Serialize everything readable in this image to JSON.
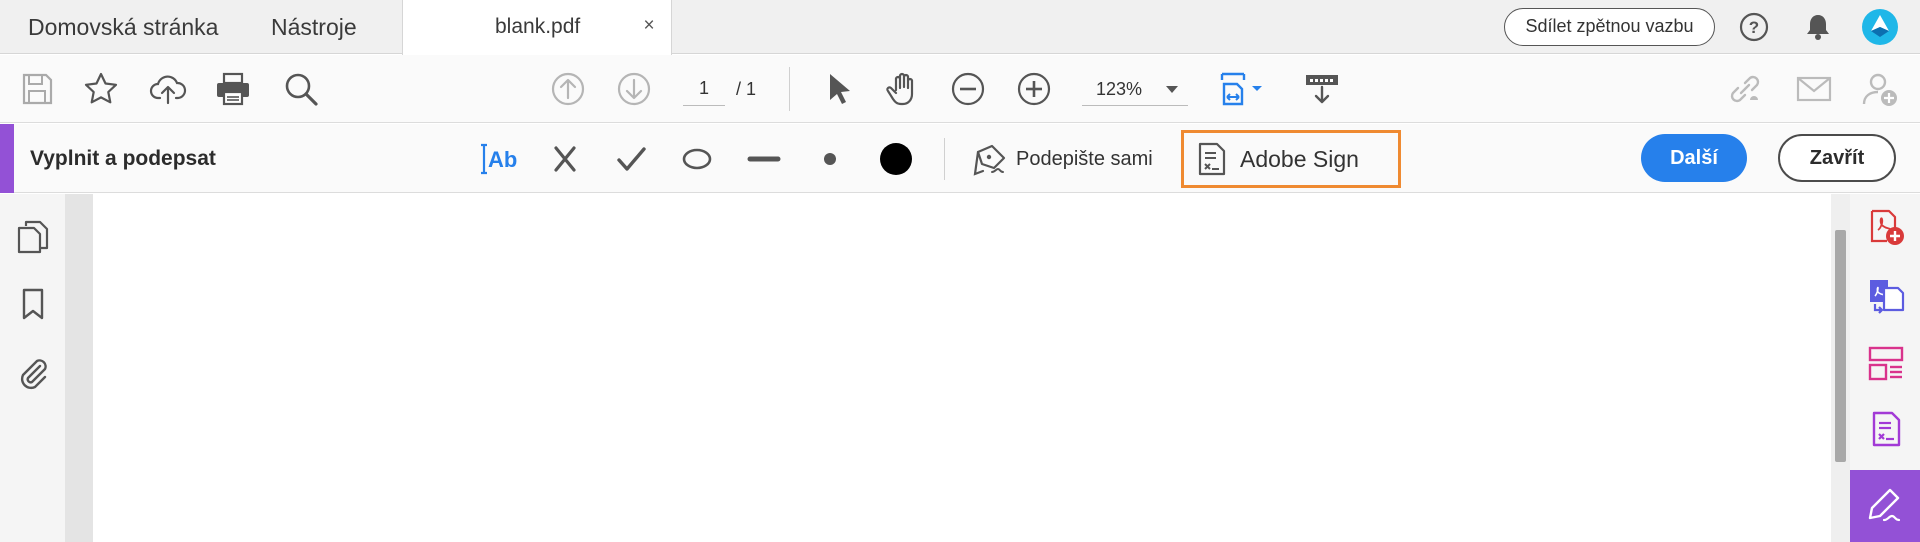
{
  "tabs": {
    "home_label": "Domovská stránka",
    "tools_label": "Nástroje",
    "document_label": "blank.pdf",
    "close_glyph": "×",
    "feedback_label": "Sdílet zpětnou vazbu",
    "help_glyph": "?"
  },
  "toolbar": {
    "page_current": "1",
    "page_total": "/ 1",
    "zoom": "123%"
  },
  "fill_sign": {
    "title": "Vyplnit a podepsat",
    "text_tool_label": "Ab",
    "sign_self_label": "Podepište sami",
    "adobe_sign_label": "Adobe Sign",
    "next_label": "Další",
    "close_label": "Zavřít"
  },
  "colors": {
    "accent_purple": "#9351d6",
    "primary_blue": "#2680eb",
    "highlight_orange": "#ef8a31",
    "pdf_red": "#d93a3a",
    "pink": "#d9338c"
  },
  "icons": {
    "toolbar": [
      "save-icon",
      "star-icon",
      "cloud-upload-icon",
      "print-icon",
      "search-icon",
      "arrow-up-icon",
      "arrow-down-icon",
      "pointer-icon",
      "hand-icon",
      "zoom-out-icon",
      "zoom-in-icon",
      "fit-page-icon",
      "scroll-mode-icon",
      "link-icon",
      "mail-icon",
      "add-user-icon"
    ],
    "fill_sign_tools": [
      "text-tool-icon",
      "cross-icon",
      "check-icon",
      "ellipse-icon",
      "line-icon",
      "dot-icon",
      "color-icon",
      "pen-icon",
      "adobe-sign-icon"
    ],
    "left_nav": [
      "pages-icon",
      "bookmark-icon",
      "attachment-icon"
    ],
    "right_panel": [
      "create-pdf-icon",
      "export-pdf-icon",
      "organize-pages-icon",
      "send-for-signature-icon",
      "fill-sign-icon"
    ]
  }
}
